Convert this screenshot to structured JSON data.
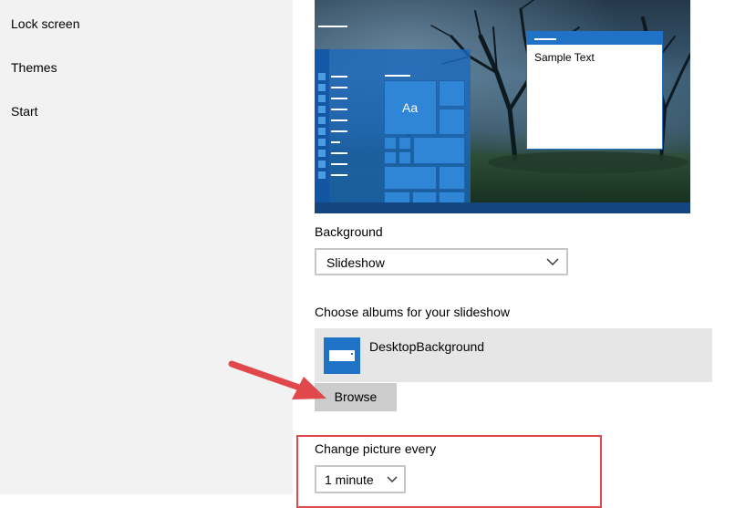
{
  "sidebar": {
    "items": [
      {
        "label": "Lock screen"
      },
      {
        "label": "Themes"
      },
      {
        "label": "Start"
      }
    ]
  },
  "preview": {
    "tile_label": "Aa",
    "sample_text": "Sample Text"
  },
  "background": {
    "label": "Background",
    "value": "Slideshow"
  },
  "albums": {
    "label": "Choose albums for your slideshow",
    "items": [
      {
        "name": "DesktopBackground",
        "icon": "folder-icon"
      }
    ],
    "browse_label": "Browse"
  },
  "change_picture": {
    "label": "Change picture every",
    "value": "1 minute"
  },
  "colors": {
    "accent": "#1f72c6",
    "annotation": "#e0484c"
  }
}
